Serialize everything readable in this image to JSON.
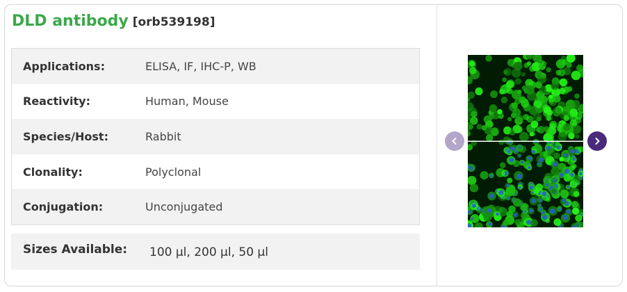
{
  "product": {
    "name": "DLD antibody",
    "catalog_number": "[orb539198]"
  },
  "specs": [
    {
      "label": "Applications:",
      "value": "ELISA,  IF,  IHC-P,  WB"
    },
    {
      "label": "Reactivity:",
      "value": "Human, Mouse"
    },
    {
      "label": "Species/Host:",
      "value": "Rabbit"
    },
    {
      "label": "Clonality:",
      "value": "Polyclonal"
    },
    {
      "label": "Conjugation:",
      "value": "Unconjugated"
    }
  ],
  "sizes": {
    "label": "Sizes Available:",
    "value": "100 µl, 200 µl, 50 µl"
  },
  "carousel": {
    "prev_icon": "chevron-left-icon",
    "next_icon": "chevron-right-icon"
  },
  "colors": {
    "title_green": "#3aa84a",
    "row_alt": "#f2f2f2",
    "nav_prev": "#b3a6c9",
    "nav_next": "#4a2a7a"
  }
}
